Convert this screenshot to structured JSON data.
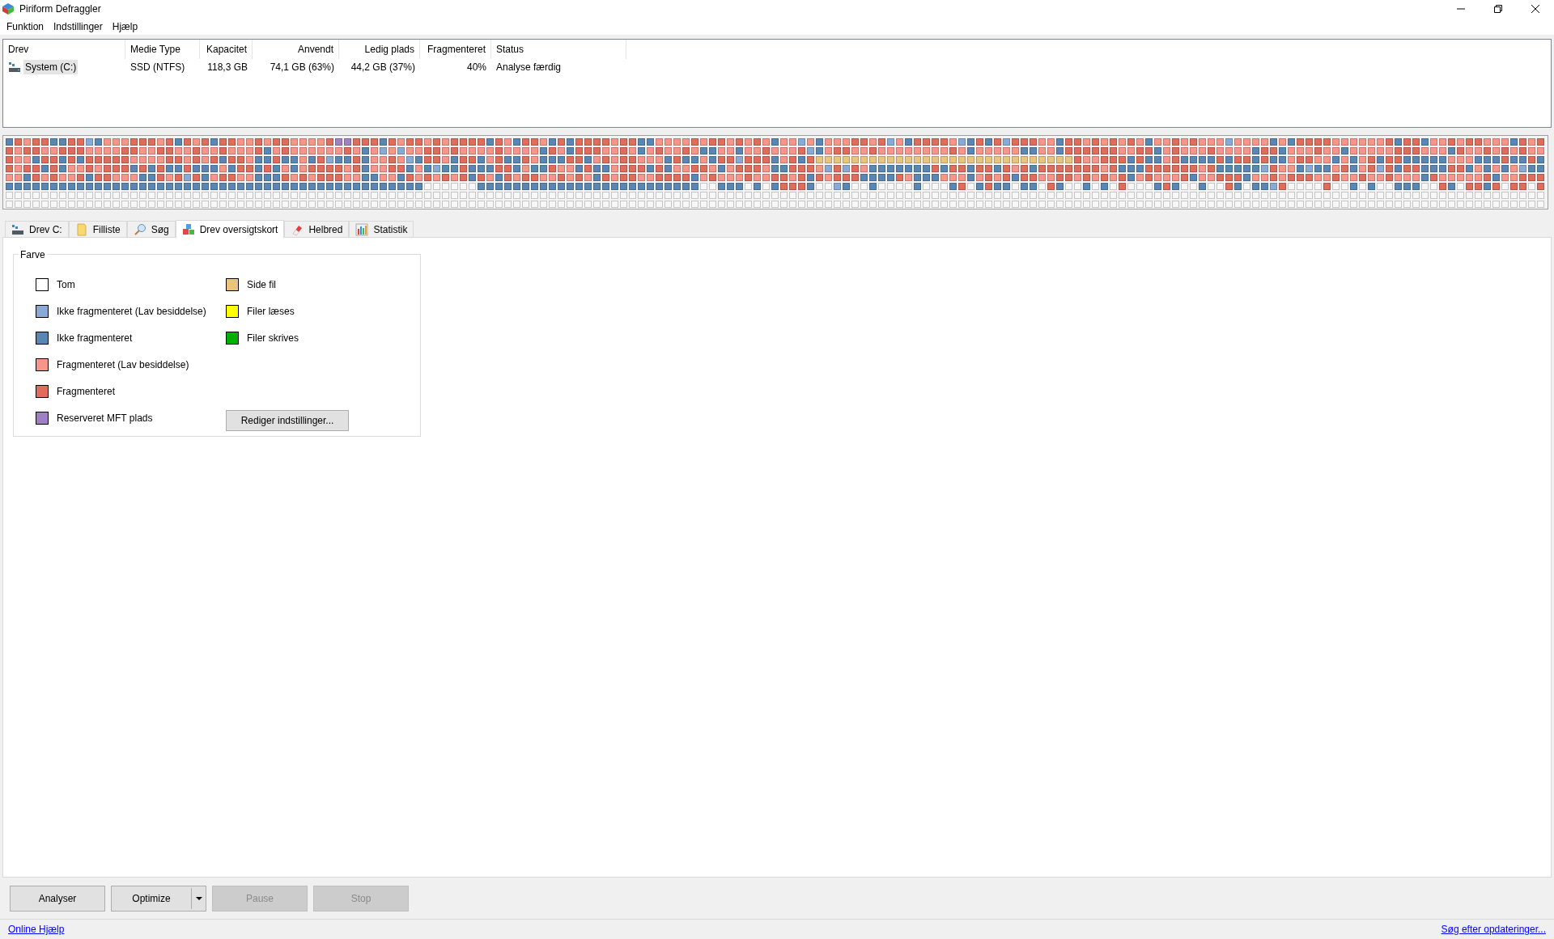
{
  "window": {
    "title": "Piriform Defraggler"
  },
  "menu": [
    "Funktion",
    "Indstillinger",
    "Hjælp"
  ],
  "drive_table": {
    "columns": [
      "Drev",
      "Medie Type",
      "Kapacitet",
      "Anvendt",
      "Ledig plads",
      "Fragmenteret",
      "Status"
    ],
    "rows": [
      {
        "selected": true,
        "cells": [
          "System (C:)",
          "SSD (NTFS)",
          "118,3 GB",
          "74,1 GB (63%)",
          "44,2 GB (37%)",
          "40%",
          "Analyse færdig"
        ]
      }
    ]
  },
  "tabs": [
    {
      "label": "Drev C:",
      "selected": false
    },
    {
      "label": "Filliste",
      "selected": false
    },
    {
      "label": "Søg",
      "selected": false
    },
    {
      "label": "Drev oversigtskort",
      "selected": true
    },
    {
      "label": "Helbred",
      "selected": false
    },
    {
      "label": "Statistik",
      "selected": false
    }
  ],
  "legend": {
    "title": "Farve",
    "items": [
      {
        "label": "Tom",
        "color": "#ffffff"
      },
      {
        "label": "Ikke fragmenteret (Lav besiddelse)",
        "color": "#8aaad6"
      },
      {
        "label": "Ikke fragmenteret",
        "color": "#5a86b4"
      },
      {
        "label": "Fragmenteret (Lav besiddelse)",
        "color": "#f8958a"
      },
      {
        "label": "Fragmenteret",
        "color": "#e06c5c"
      },
      {
        "label": "Reserveret MFT plads",
        "color": "#a080c4"
      },
      {
        "label": "Side fil",
        "color": "#e8c47c"
      },
      {
        "label": "Filer læses",
        "color": "#ffff00"
      },
      {
        "label": "Filer skrives",
        "color": "#00b000"
      }
    ],
    "settings_button": "Rediger indstillinger..."
  },
  "actions": [
    {
      "label": "Analyser",
      "kind": "plain",
      "disabled": false
    },
    {
      "label": "Optimize",
      "kind": "split",
      "disabled": false
    },
    {
      "label": "Pause",
      "kind": "plain",
      "disabled": true
    },
    {
      "label": "Stop",
      "kind": "plain",
      "disabled": true
    }
  ],
  "footer": {
    "help_link": "Online Hjælp",
    "update_link": "Søg efter opdateringer..."
  }
}
